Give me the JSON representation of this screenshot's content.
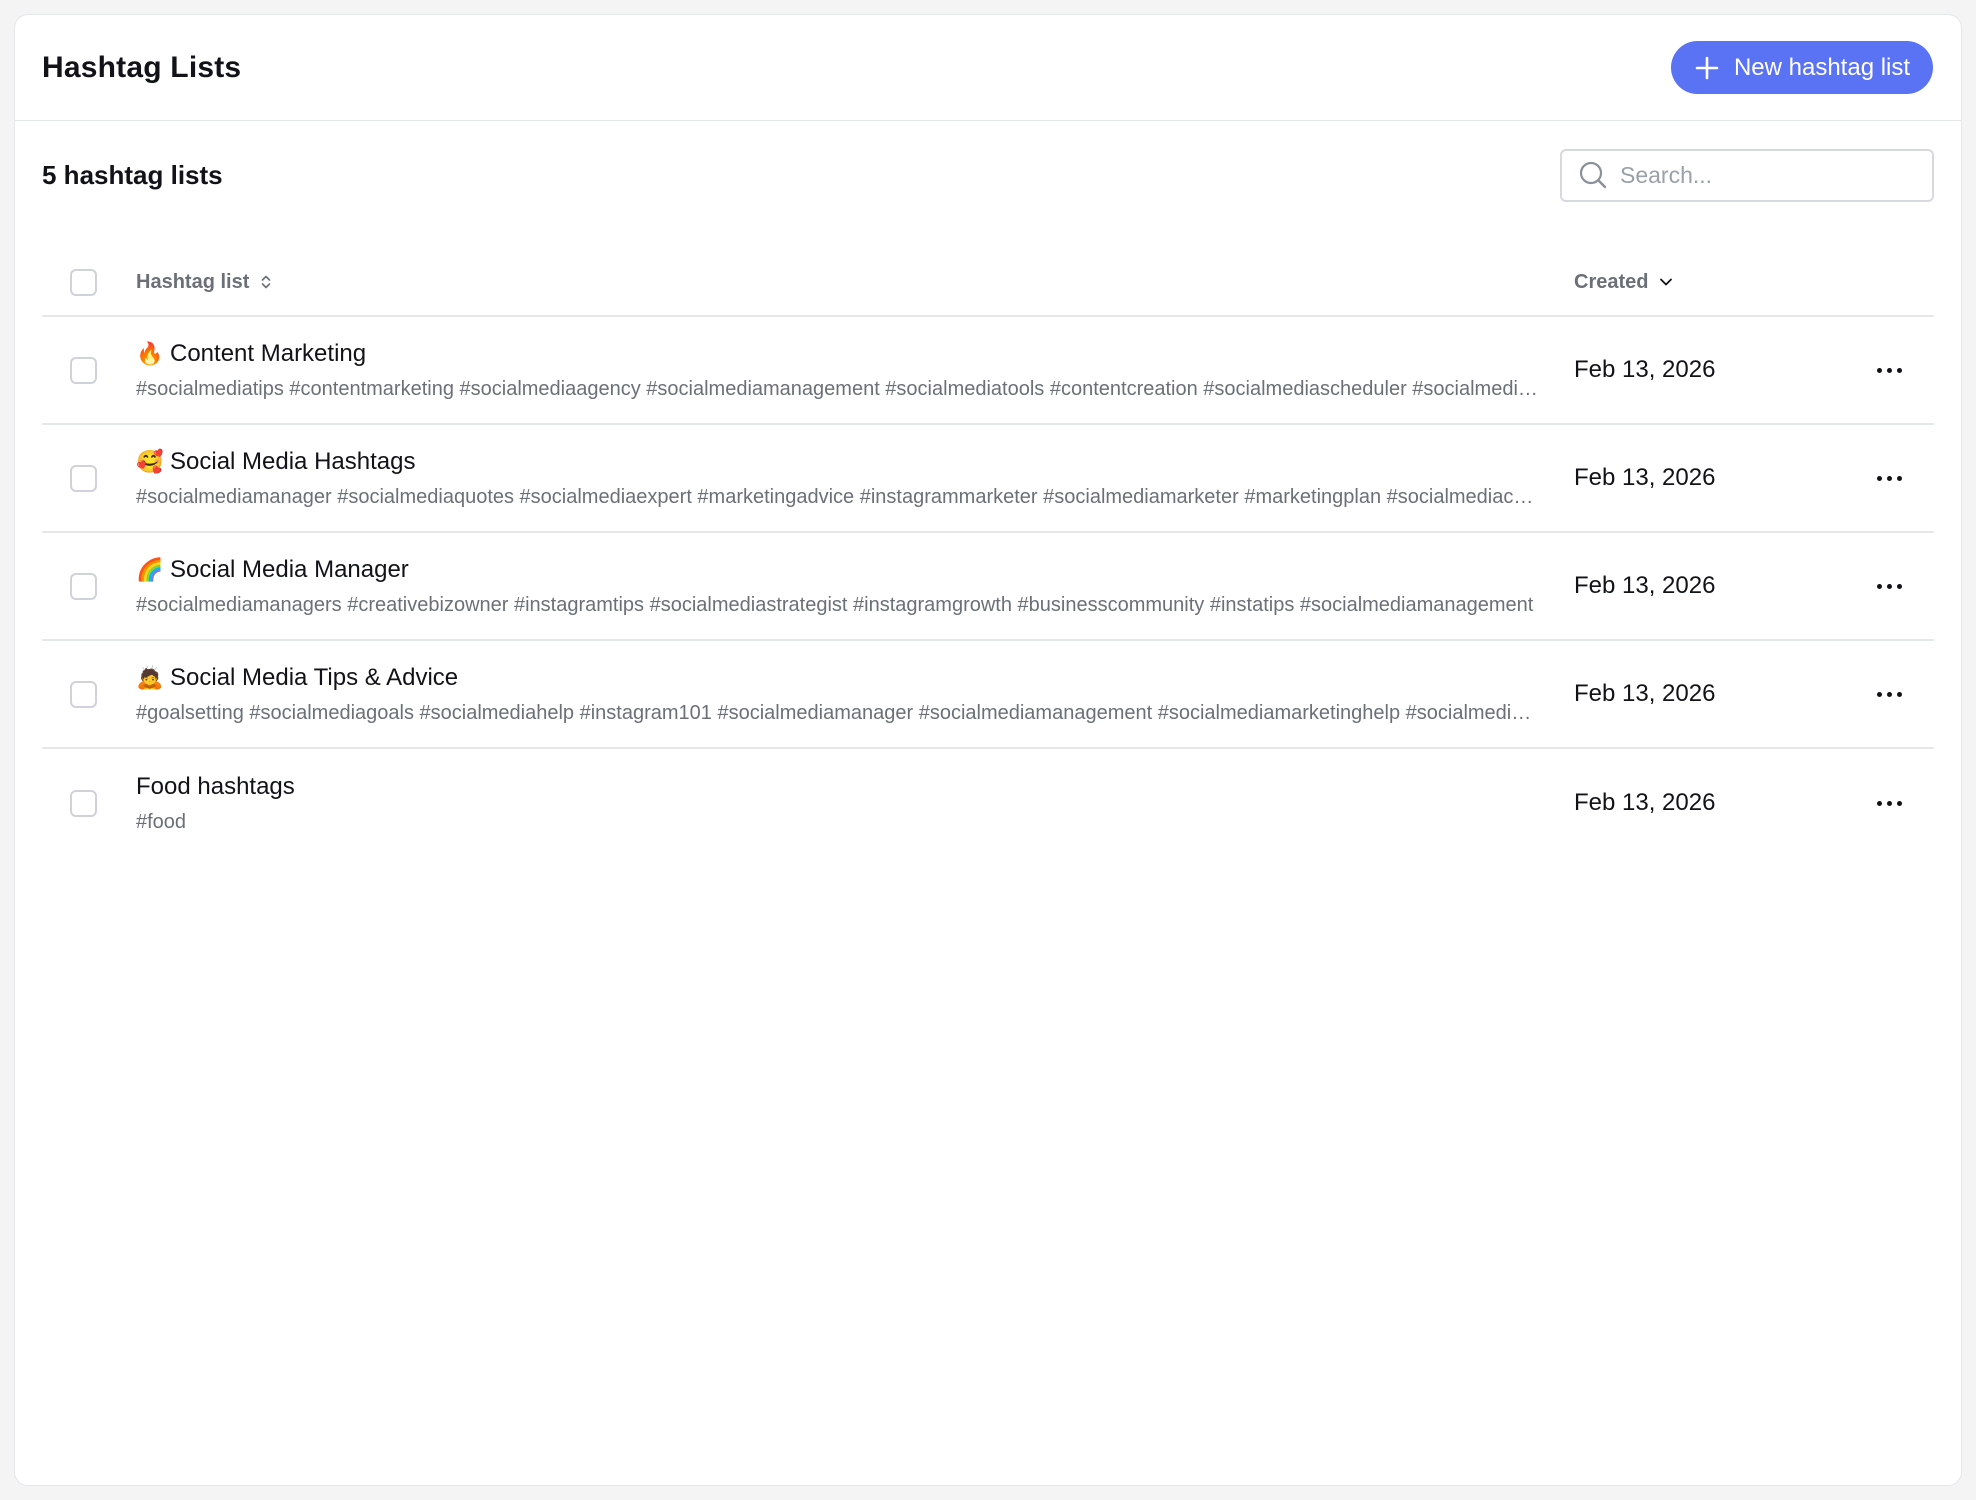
{
  "header": {
    "title": "Hashtag Lists",
    "new_button_label": "New hashtag list"
  },
  "toolbar": {
    "count_label": "5 hashtag lists",
    "search_placeholder": "Search..."
  },
  "table": {
    "columns": {
      "name": "Hashtag list",
      "created": "Created"
    },
    "rows": [
      {
        "emoji": "🔥",
        "name": "Content Marketing",
        "tags": "#socialmediatips #contentmarketing #socialmediaagency #socialmediamanagement #socialmediatools #contentcreation #socialmediascheduler #socialmediaplanner",
        "created": "Feb 13, 2026"
      },
      {
        "emoji": "🥰",
        "name": "Social Media Hashtags",
        "tags": "#socialmediamanager #socialmediaquotes #socialmediaexpert #marketingadvice #instagrammarketer #socialmediamarketer #marketingplan #socialmediacoach",
        "created": "Feb 13, 2026"
      },
      {
        "emoji": "🌈",
        "name": "Social Media Manager",
        "tags": "#socialmediamanagers #creativebizowner #instagramtips #socialmediastrategist #instagramgrowth #businesscommunity #instatips #socialmediamanagement",
        "created": "Feb 13, 2026"
      },
      {
        "emoji": "🙇",
        "name": "Social Media Tips & Advice",
        "tags": "#goalsetting #socialmediagoals #socialmediahelp #instagram101 #socialmediamanager #socialmediamanagement #socialmediamarketinghelp #socialmediatips",
        "created": "Feb 13, 2026"
      },
      {
        "emoji": "",
        "name": "Food hashtags",
        "tags": "#food",
        "created": "Feb 13, 2026"
      }
    ]
  },
  "colors": {
    "accent": "#5a72f4",
    "border": "#e6e7eb",
    "muted_text": "#6b7078"
  }
}
